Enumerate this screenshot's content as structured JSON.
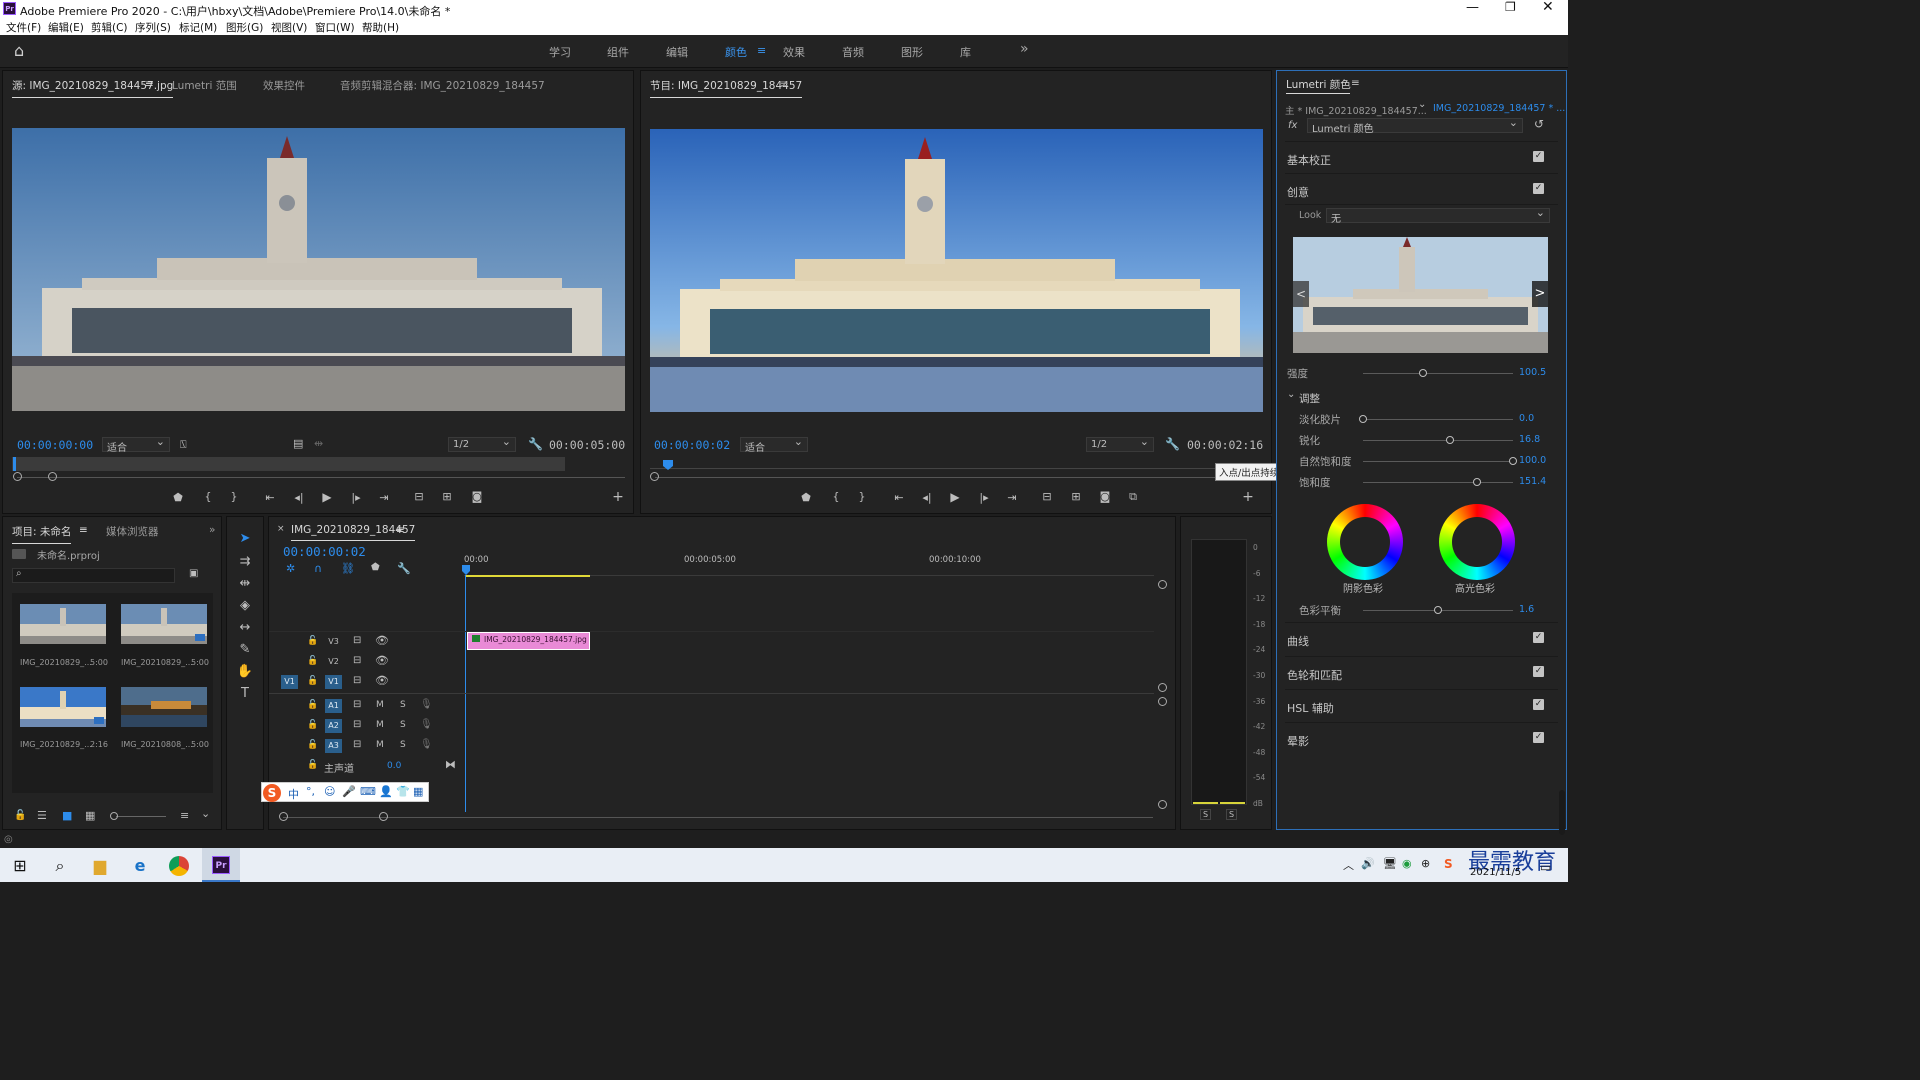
{
  "app": {
    "title": "Adobe Premiere Pro 2020 - C:\\用户\\hbxy\\文档\\Adobe\\Premiere Pro\\14.0\\未命名 *",
    "logo": "Pr",
    "window_controls": [
      "minimize-icon",
      "maximize-icon",
      "close-icon"
    ]
  },
  "menu": [
    "文件(F)",
    "编辑(E)",
    "剪辑(C)",
    "序列(S)",
    "标记(M)",
    "图形(G)",
    "视图(V)",
    "窗口(W)",
    "帮助(H)"
  ],
  "workspaces": {
    "items": [
      "学习",
      "组件",
      "编辑",
      "颜色",
      "效果",
      "音频",
      "图形",
      "库"
    ],
    "active": "颜色",
    "menu_glyph": "≡",
    "more_glyph": "»"
  },
  "source": {
    "tabs": [
      "源: IMG_20210829_184457.jpg",
      "Lumetri 范围",
      "效果控件",
      "音频剪辑混合器: IMG_20210829_184457"
    ],
    "menu_glyph": "≡",
    "timecode_in": "00:00:00:00",
    "fit": "适合",
    "resolution": "1/2",
    "timecode_dur": "00:00:05:00"
  },
  "program": {
    "title": "节目: IMG_20210829_184457",
    "timecode_in": "00:00:00:02",
    "fit": "适合",
    "resolution": "1/2",
    "timecode_dur": "00:00:02:16",
    "tooltip": "入点/出点持续时间"
  },
  "project": {
    "tabs": [
      "项目: 未命名",
      "媒体浏览器"
    ],
    "file": "未命名.prproj",
    "items": [
      {
        "name": "IMG_20210829_...",
        "dur": "5:00"
      },
      {
        "name": "IMG_20210829_...",
        "dur": "5:00"
      },
      {
        "name": "IMG_20210829_...",
        "dur": "2:16"
      },
      {
        "name": "IMG_20210808_...",
        "dur": "5:00"
      }
    ]
  },
  "timeline": {
    "tab": "IMG_20210829_184457",
    "timecode": "00:00:00:02",
    "ruler": [
      "00:00",
      "00:00:05:00",
      "00:00:10:00"
    ],
    "clip": "IMG_20210829_184457.jpg",
    "video_tracks": [
      "V3",
      "V2",
      "V1"
    ],
    "source_patch": "V1",
    "audio_tracks": [
      "A1",
      "A2",
      "A3"
    ],
    "m": "M",
    "s": "S",
    "master": "主声道",
    "master_val": "0.0"
  },
  "meter": {
    "scale": [
      "0",
      "-6",
      "-12",
      "-18",
      "-24",
      "-30",
      "-36",
      "-42",
      "-48",
      "-54",
      "dB"
    ],
    "solo": [
      "S",
      "S"
    ]
  },
  "lumetri": {
    "title": "Lumetri 颜色",
    "menu_glyph": "≡",
    "master_clip": "主 * IMG_20210829_184457...",
    "seq_clip": "IMG_20210829_184457 * ...",
    "fx_label": "fx",
    "effect": "Lumetri 颜色",
    "sections": {
      "basic": "基本校正",
      "creative": "创意",
      "curves": "曲线",
      "wheels": "色轮和匹配",
      "hsl": "HSL 辅助",
      "vignette": "晕影"
    },
    "look_label": "Look",
    "look_value": "无",
    "intensity": {
      "label": "强度",
      "value": "100.5",
      "frac": 0.4
    },
    "adjust": "调整",
    "sliders": [
      {
        "label": "淡化胶片",
        "value": "0.0",
        "frac": 0.0
      },
      {
        "label": "锐化",
        "value": "16.8",
        "frac": 0.58
      },
      {
        "label": "自然饱和度",
        "value": "100.0",
        "frac": 1.0
      },
      {
        "label": "饱和度",
        "value": "151.4",
        "frac": 0.76
      }
    ],
    "shadow_tint": "阴影色彩",
    "highlight_tint": "高光色彩",
    "tint_balance": {
      "label": "色彩平衡",
      "value": "1.6",
      "frac": 0.5
    }
  },
  "ime": {
    "lang": "中"
  },
  "taskbar": {
    "date": "2021/11/5",
    "watermark": "最需教育"
  }
}
